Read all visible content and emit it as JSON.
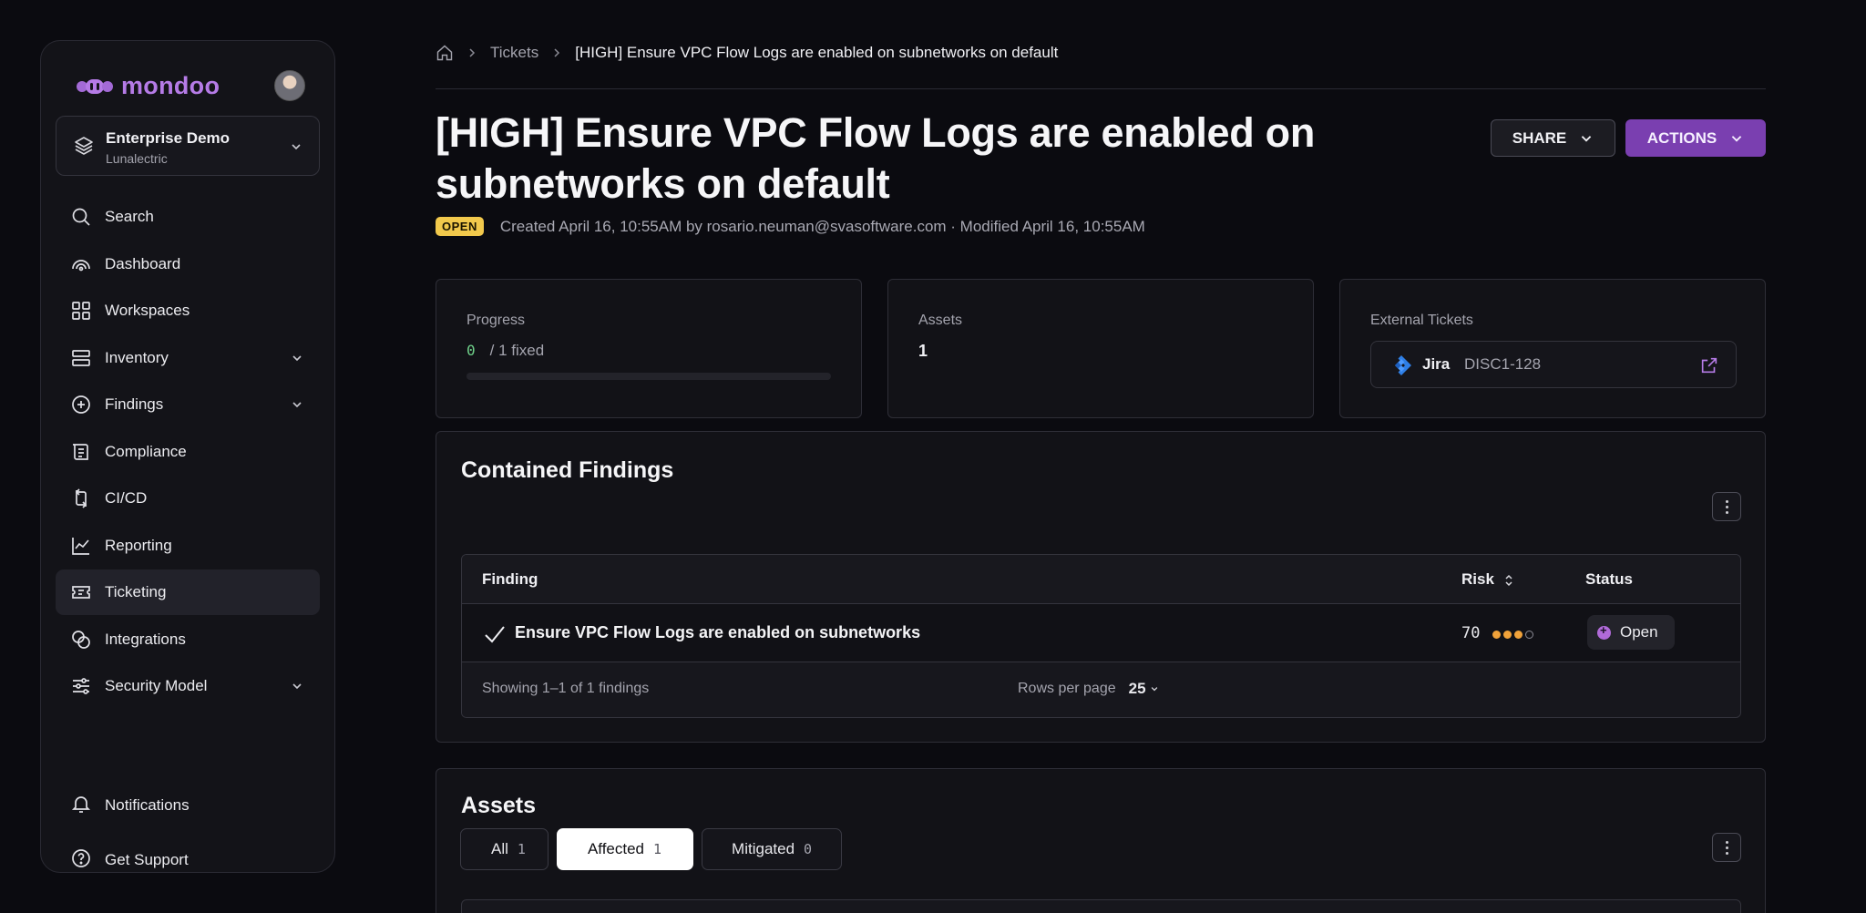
{
  "app": {
    "logo_text": "mondoo",
    "brand_color": "#b57be6"
  },
  "org": {
    "name": "Enterprise Demo",
    "sub": "Lunalectric"
  },
  "nav": {
    "items": [
      {
        "label": "Search",
        "icon": "search-icon"
      },
      {
        "label": "Dashboard",
        "icon": "dashboard-icon"
      },
      {
        "label": "Workspaces",
        "icon": "workspaces-icon"
      },
      {
        "label": "Inventory",
        "icon": "inventory-icon"
      },
      {
        "label": "Findings",
        "icon": "findings-icon"
      },
      {
        "label": "Compliance",
        "icon": "compliance-icon"
      },
      {
        "label": "CI/CD",
        "icon": "cicd-icon"
      },
      {
        "label": "Reporting",
        "icon": "reporting-icon"
      },
      {
        "label": "Ticketing",
        "icon": "ticketing-icon"
      },
      {
        "label": "Integrations",
        "icon": "integrations-icon"
      },
      {
        "label": "Security Model",
        "icon": "security-model-icon"
      }
    ],
    "active": "Ticketing",
    "bottom": [
      {
        "label": "Notifications",
        "icon": "bell-icon"
      },
      {
        "label": "Get Support",
        "icon": "help-icon"
      }
    ]
  },
  "breadcrumb": {
    "level1": "Tickets",
    "current": "[HIGH] Ensure VPC Flow Logs are enabled on subnetworks on default"
  },
  "ticket": {
    "title": "[HIGH] Ensure VPC Flow Logs are enabled on subnetworks on default",
    "status": "OPEN",
    "meta": "Created April 16, 10:55AM by rosario.neuman@svasoftware.com · Modified April 16, 10:55AM"
  },
  "buttons": {
    "share": "SHARE",
    "actions": "ACTIONS"
  },
  "cards": {
    "progress": {
      "label": "Progress",
      "fixed": "0",
      "total_text": "/ 1 fixed",
      "fraction": 0
    },
    "assets": {
      "label": "Assets",
      "value": "1"
    },
    "external": {
      "label": "External Tickets",
      "system": "Jira",
      "key": "DISC1-128"
    }
  },
  "findings": {
    "title": "Contained Findings",
    "columns": {
      "finding": "Finding",
      "risk": "Risk",
      "status": "Status"
    },
    "rows": [
      {
        "name": "Ensure VPC Flow Logs are enabled on subnetworks",
        "score": "70",
        "risk_level": 3,
        "status": "Open"
      }
    ],
    "footer": {
      "showing": "Showing 1–1 of 1 findings",
      "rpp_label": "Rows per page",
      "rpp_value": "25"
    }
  },
  "assets": {
    "title": "Assets",
    "tabs": [
      {
        "label": "All",
        "count": "1"
      },
      {
        "label": "Affected",
        "count": "1"
      },
      {
        "label": "Mitigated",
        "count": "0"
      }
    ],
    "selected_tab": "Affected"
  }
}
